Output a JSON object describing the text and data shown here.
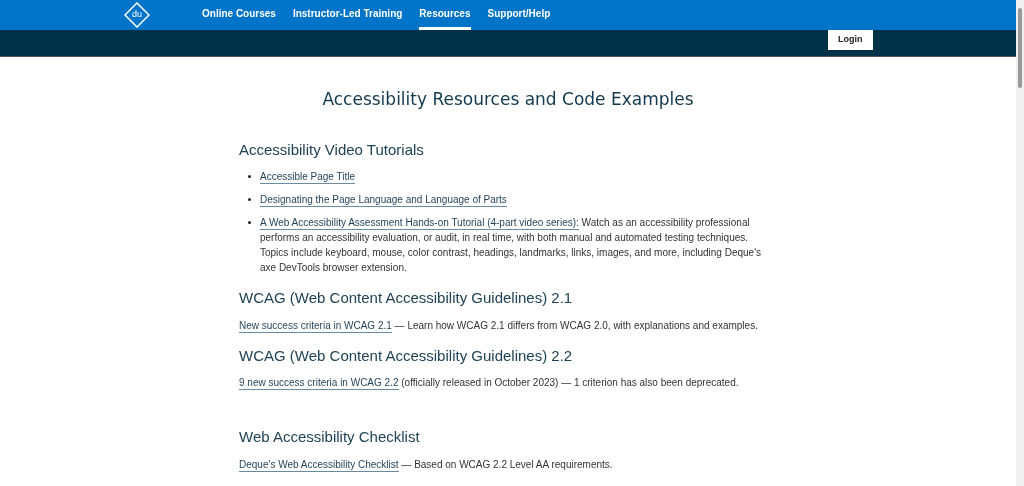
{
  "logo": {
    "mark": "du"
  },
  "nav": [
    {
      "label": "Online Courses",
      "selected": false
    },
    {
      "label": "Instructor-Led Training",
      "selected": false
    },
    {
      "label": "Resources",
      "selected": true
    },
    {
      "label": "Support/Help",
      "selected": false
    }
  ],
  "login_button": "Login",
  "title": "Accessibility Resources and Code Examples",
  "sections": [
    {
      "heading": "Accessibility Video Tutorials",
      "kind": "list",
      "items": [
        {
          "link": "Accessible Page Title"
        },
        {
          "link": "Designating the Page Language and Language of Parts"
        },
        {
          "link": "A Web Accessibility Assessment Hands-on Tutorial (4-part video series):",
          "text": "Watch as an accessibility professional performs an accessibility evaluation, or audit, in real time, with both manual and automated testing techniques. Topics include keyboard, mouse, color contrast, headings, landmarks, links, images, and more, including Deque's axe DevTools browser extension."
        }
      ]
    },
    {
      "heading": "WCAG (Web Content Accessibility Guidelines) 2.1",
      "kind": "paragraph",
      "items": [
        {
          "link": "New success criteria in WCAG 2.1",
          "text": "— Learn how WCAG 2.1 differs from WCAG 2.0, with explanations and examples."
        }
      ]
    },
    {
      "heading": "WCAG (Web Content Accessibility Guidelines) 2.2",
      "kind": "paragraph",
      "items": [
        {
          "link": "9 new success criteria in WCAG 2.2",
          "text": "(officially released in October 2023) — 1 criterion has also been deprecated."
        }
      ]
    },
    {
      "heading": "Web Accessibility Checklist",
      "kind": "paragraph",
      "items": [
        {
          "link": "Deque's Web Accessibility Checklist",
          "text": "— Based on WCAG 2.2 Level AA requirements."
        }
      ]
    }
  ]
}
